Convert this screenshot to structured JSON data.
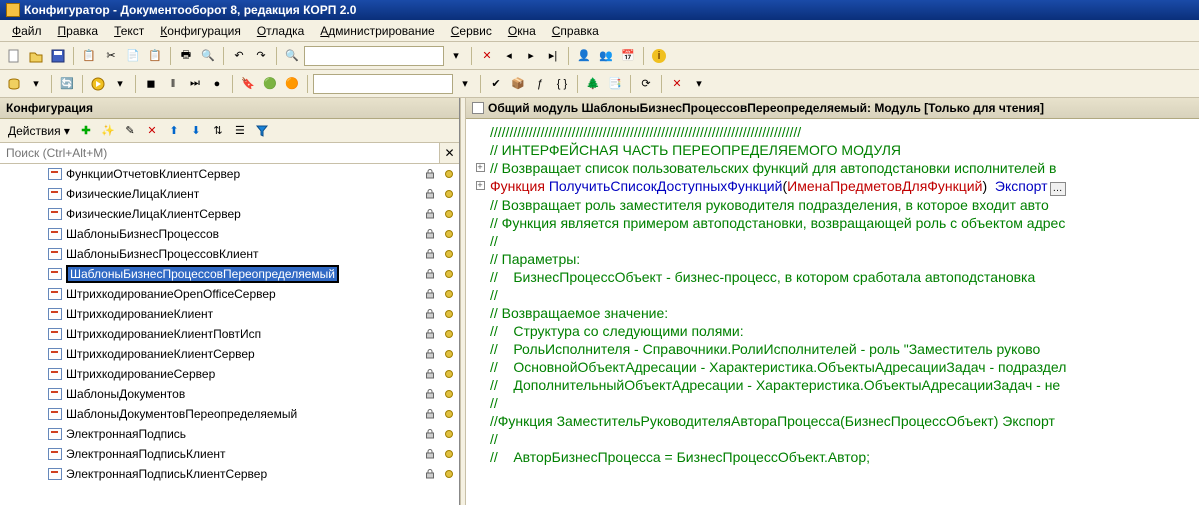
{
  "window": {
    "title": "Конфигуратор - Документооборот 8, редакция КОРП 2.0"
  },
  "menu": {
    "items": [
      "Файл",
      "Правка",
      "Текст",
      "Конфигурация",
      "Отладка",
      "Администрирование",
      "Сервис",
      "Окна",
      "Справка"
    ]
  },
  "left_pane": {
    "title": "Конфигурация",
    "actions_label": "Действия",
    "search_placeholder": "Поиск (Ctrl+Alt+M)",
    "tree": [
      {
        "label": "ФункцииОтчетовКлиентСервер",
        "lock": true,
        "dot": true,
        "selected": false
      },
      {
        "label": "ФизическиеЛицаКлиент",
        "lock": true,
        "dot": true,
        "selected": false
      },
      {
        "label": "ФизическиеЛицаКлиентСервер",
        "lock": true,
        "dot": true,
        "selected": false
      },
      {
        "label": "ШаблоныБизнесПроцессов",
        "lock": true,
        "dot": true,
        "selected": false
      },
      {
        "label": "ШаблоныБизнесПроцессовКлиент",
        "lock": true,
        "dot": true,
        "selected": false
      },
      {
        "label": "ШаблоныБизнесПроцессовПереопределяемый",
        "lock": true,
        "dot": true,
        "selected": true
      },
      {
        "label": "ШтрихкодированиеOpenOfficeСервер",
        "lock": true,
        "dot": true,
        "selected": false
      },
      {
        "label": "ШтрихкодированиеКлиент",
        "lock": true,
        "dot": true,
        "selected": false
      },
      {
        "label": "ШтрихкодированиеКлиентПовтИсп",
        "lock": true,
        "dot": true,
        "selected": false
      },
      {
        "label": "ШтрихкодированиеКлиентСервер",
        "lock": true,
        "dot": true,
        "selected": false
      },
      {
        "label": "ШтрихкодированиеСервер",
        "lock": true,
        "dot": true,
        "selected": false
      },
      {
        "label": "ШаблоныДокументов",
        "lock": true,
        "dot": true,
        "selected": false
      },
      {
        "label": "ШаблоныДокументовПереопределяемый",
        "lock": true,
        "dot": true,
        "selected": false
      },
      {
        "label": "ЭлектроннаяПодпись",
        "lock": true,
        "dot": true,
        "selected": false
      },
      {
        "label": "ЭлектроннаяПодписьКлиент",
        "lock": true,
        "dot": true,
        "selected": false
      },
      {
        "label": "ЭлектроннаяПодписьКлиентСервер",
        "lock": true,
        "dot": true,
        "selected": false
      }
    ]
  },
  "editor": {
    "title": "Общий модуль ШаблоныБизнесПроцессовПереопределяемый: Модуль [Только для чтения]",
    "lines": [
      {
        "fold": "",
        "t": [
          [
            "green",
            "////////////////////////////////////////////////////////////////////////////////"
          ]
        ]
      },
      {
        "fold": "",
        "t": [
          [
            "green",
            "// ИНТЕРФЕЙСНАЯ ЧАСТЬ ПЕРЕОПРЕДЕЛЯЕМОГО МОДУЛЯ"
          ]
        ]
      },
      {
        "fold": "",
        "t": [
          [
            "black",
            ""
          ]
        ]
      },
      {
        "fold": "+",
        "t": [
          [
            "green",
            "// Возвращает список пользовательских функций для автоподстановки исполнителей в"
          ]
        ]
      },
      {
        "fold": "+",
        "t": [
          [
            "red",
            "Функция "
          ],
          [
            "blue",
            "ПолучитьСписокДоступныхФункций"
          ],
          [
            "black",
            "("
          ],
          [
            "red",
            "ИменаПредметовДляФункций"
          ],
          [
            "black",
            ")  "
          ],
          [
            "blue",
            "Экспорт"
          ]
        ],
        "box": true
      },
      {
        "fold": "",
        "t": [
          [
            "black",
            ""
          ]
        ]
      },
      {
        "fold": "",
        "t": [
          [
            "green",
            "// Возвращает роль заместителя руководителя подразделения, в которое входит авто"
          ]
        ]
      },
      {
        "fold": "",
        "t": [
          [
            "green",
            "// Функция является примером автоподстановки, возвращающей роль с объектом адрес"
          ]
        ]
      },
      {
        "fold": "",
        "t": [
          [
            "green",
            "//"
          ]
        ]
      },
      {
        "fold": "",
        "t": [
          [
            "green",
            "// Параметры:"
          ]
        ]
      },
      {
        "fold": "",
        "t": [
          [
            "green",
            "//    БизнесПроцессОбъект - бизнес-процесс, в котором сработала автоподстановка "
          ]
        ]
      },
      {
        "fold": "",
        "t": [
          [
            "green",
            "//"
          ]
        ]
      },
      {
        "fold": "",
        "t": [
          [
            "green",
            "// Возвращаемое значение:"
          ]
        ]
      },
      {
        "fold": "",
        "t": [
          [
            "green",
            "//    Структура со следующими полями:"
          ]
        ]
      },
      {
        "fold": "",
        "t": [
          [
            "green",
            "//    РольИсполнителя - Справочники.РолиИсполнителей - роль \"Заместитель руково"
          ]
        ]
      },
      {
        "fold": "",
        "t": [
          [
            "green",
            "//    ОсновнойОбъектАдресации - Характеристика.ОбъектыАдресацииЗадач - подраздел"
          ]
        ]
      },
      {
        "fold": "",
        "t": [
          [
            "green",
            "//    ДополнительныйОбъектАдресации - Характеристика.ОбъектыАдресацииЗадач - не "
          ]
        ]
      },
      {
        "fold": "",
        "t": [
          [
            "green",
            "//"
          ]
        ]
      },
      {
        "fold": "",
        "t": [
          [
            "green",
            "//Функция ЗаместительРуководителяАвтораПроцесса(БизнесПроцессОбъект) Экспорт"
          ]
        ]
      },
      {
        "fold": "",
        "t": [
          [
            "green",
            "//"
          ]
        ]
      },
      {
        "fold": "",
        "t": [
          [
            "green",
            "//    АвторБизнесПроцесса = БизнесПроцессОбъект.Автор;"
          ]
        ]
      }
    ]
  }
}
